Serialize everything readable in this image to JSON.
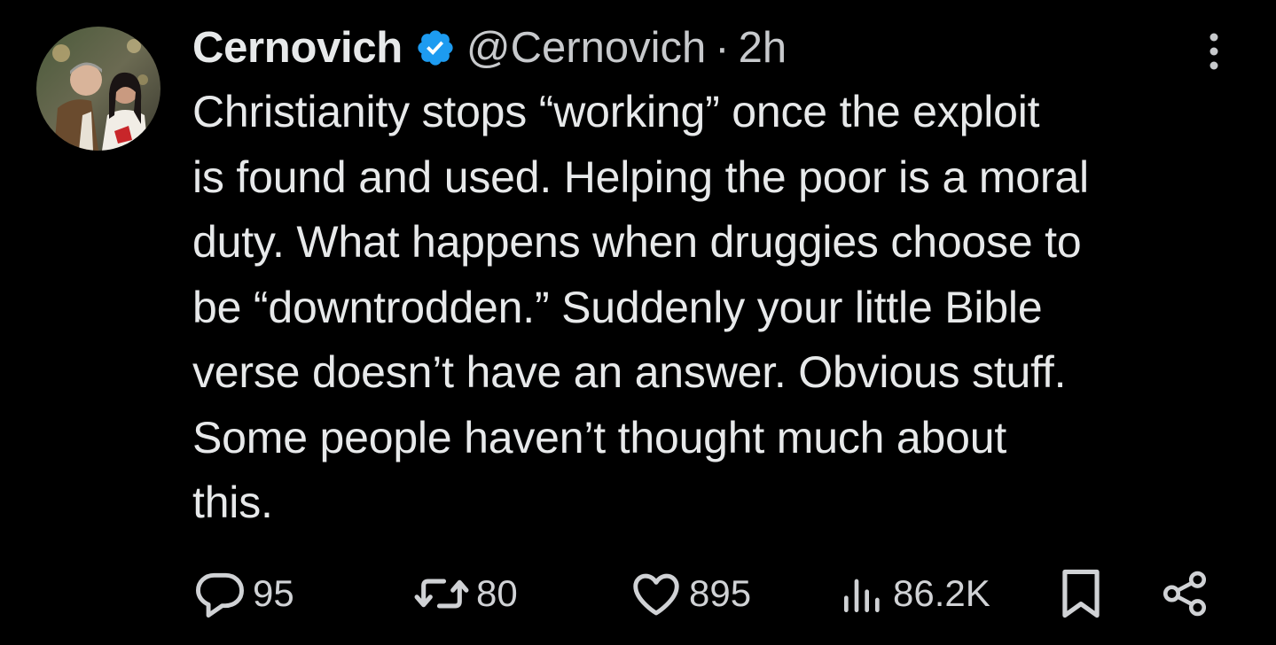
{
  "tweet": {
    "display_name": "Cernovich",
    "handle": "@Cernovich",
    "separator": "·",
    "time": "2h",
    "text": "Christianity stops “working” once the exploit\nis found and used. Helping the poor is a moral\nduty. What happens when druggies choose to\nbe “downtrodden.” Suddenly your little Bible\nverse doesn’t have an answer. Obvious stuff.\nSome people haven’t thought much about\nthis.",
    "verified_color": "#1d9bf0"
  },
  "actions": {
    "replies": "95",
    "reposts": "80",
    "likes": "895",
    "views": "86.2K"
  },
  "icons": {
    "avatar": "profile-photo",
    "verified": "verified-badge-icon",
    "more": "more-vertical-icon",
    "reply": "reply-icon",
    "repost": "repost-icon",
    "like": "heart-icon",
    "views": "views-icon",
    "bookmark": "bookmark-icon",
    "share": "share-icon"
  },
  "colors": {
    "background": "#000000",
    "text": "#e7e9ea",
    "secondary": "#c7c9cc",
    "verified": "#1d9bf0"
  }
}
